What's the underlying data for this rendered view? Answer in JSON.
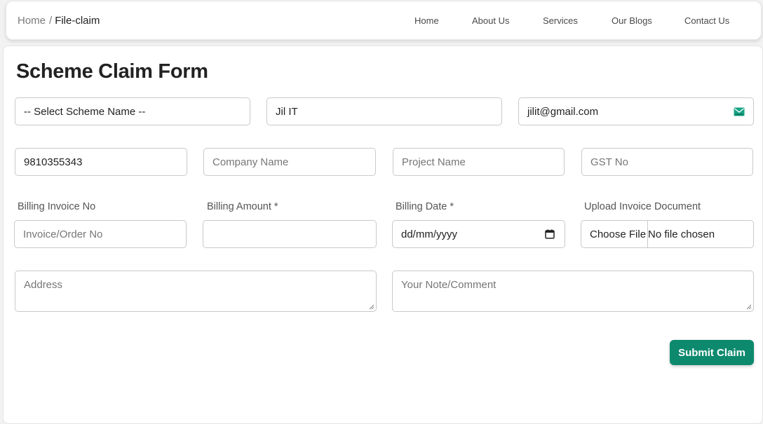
{
  "breadcrumb": {
    "home": "Home",
    "separator": "/",
    "current": "File-claim"
  },
  "nav": {
    "items": [
      "Home",
      "About Us",
      "Services",
      "Our Blogs",
      "Contact Us"
    ]
  },
  "form": {
    "title": "Scheme Claim Form",
    "scheme_select": {
      "value": "-- Select Scheme Name --"
    },
    "name": {
      "value": "Jil IT"
    },
    "email": {
      "value": "jilit@gmail.com"
    },
    "phone": {
      "value": "9810355343"
    },
    "company": {
      "placeholder": "Company Name"
    },
    "project": {
      "placeholder": "Project Name"
    },
    "gst": {
      "placeholder": "GST No"
    },
    "invoice_no": {
      "label": "Billing Invoice No",
      "placeholder": "Invoice/Order No"
    },
    "amount": {
      "label": "Billing Amount *",
      "value": ""
    },
    "date": {
      "label": "Billing Date *",
      "placeholder": "dd/mm/yyyy"
    },
    "upload": {
      "label": "Upload Invoice Document",
      "button": "Choose File",
      "status": "No file chosen"
    },
    "address": {
      "placeholder": "Address"
    },
    "note": {
      "placeholder": "Your Note/Comment"
    },
    "submit_label": "Submit Claim"
  },
  "colors": {
    "accent": "#0d8a6e",
    "email_icon": "#16a383"
  }
}
